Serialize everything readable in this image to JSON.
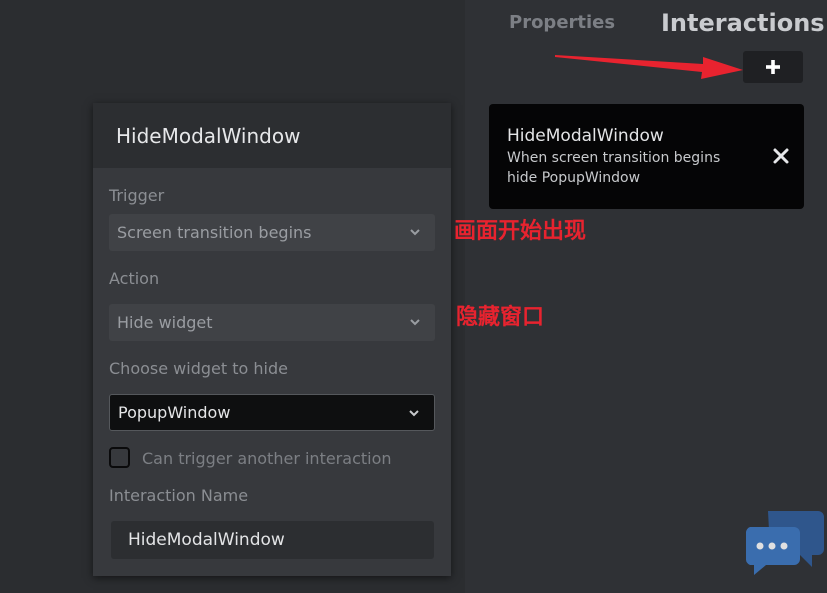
{
  "tabs": {
    "properties": "Properties",
    "interactions": "Interactions"
  },
  "add_button": {
    "icon": "plus-icon"
  },
  "interaction_card": {
    "title": "HideModalWindow",
    "line1": "When screen transition begins",
    "line2": "hide PopupWindow",
    "close_icon": "close-icon"
  },
  "panel": {
    "title": "HideModalWindow",
    "trigger_label": "Trigger",
    "trigger_value": "Screen transition begins",
    "action_label": "Action",
    "action_value": "Hide widget",
    "widget_label": "Choose widget to hide",
    "widget_value": "PopupWindow",
    "checkbox_label": "Can trigger another interaction",
    "checkbox_checked": false,
    "name_label": "Interaction Name",
    "name_value": "HideModalWindow"
  },
  "annotations": {
    "trigger_note": "画面开始出现",
    "action_note": "隐藏窗口"
  },
  "colors": {
    "annotation": "#e8232f",
    "card_bg": "#050506",
    "panel_bg": "#37393d"
  }
}
